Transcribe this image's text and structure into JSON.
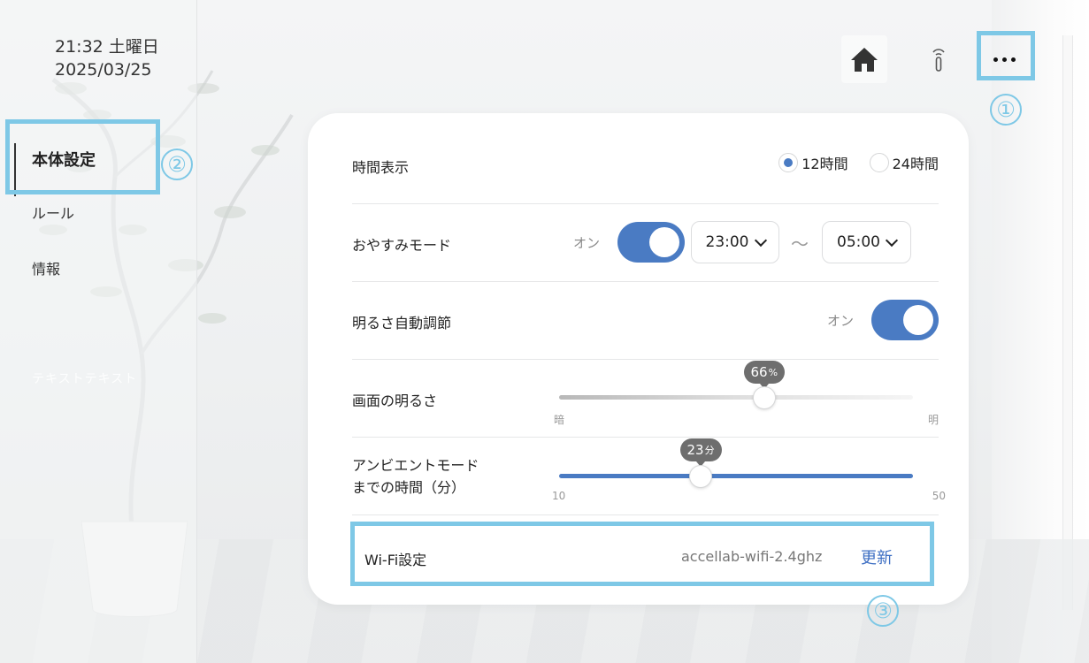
{
  "clock": {
    "time_day": "21:32 土曜日",
    "date": "2025/03/25"
  },
  "sidebar": {
    "items": [
      {
        "label": "本体設定"
      },
      {
        "label": "ルール"
      },
      {
        "label": "情報"
      }
    ],
    "faint_text": "テキストテキスト"
  },
  "header": {
    "icons": [
      "home-icon",
      "remote-icon",
      "more-icon"
    ]
  },
  "annotations": {
    "one": "①",
    "two": "②",
    "three": "③"
  },
  "settings": {
    "time_display": {
      "label": "時間表示",
      "options": [
        "12時間",
        "24時間"
      ],
      "selected": "12時間"
    },
    "sleep_mode": {
      "label": "おやすみモード",
      "toggle_label": "オン",
      "from": "23:00",
      "to": "05:00",
      "separator": "〜"
    },
    "auto_brightness": {
      "label": "明るさ自動調節",
      "toggle_label": "オン"
    },
    "brightness": {
      "label": "画面の明るさ",
      "value": "66",
      "unit": "%",
      "min_label": "暗",
      "max_label": "明",
      "fraction": 0.58
    },
    "ambient": {
      "label_line1": "アンビエントモード",
      "label_line2": "までの時間（分）",
      "value": "23",
      "unit": "分",
      "min_label": "10",
      "max_label": "50",
      "fraction": 0.4
    },
    "wifi": {
      "label": "Wi-Fi設定",
      "ssid": "accellab-wifi-2.4ghz",
      "update_label": "更新"
    }
  },
  "colors": {
    "accent": "#4a7bc3",
    "highlight": "#7ec8e6",
    "link": "#3e6fc3"
  }
}
